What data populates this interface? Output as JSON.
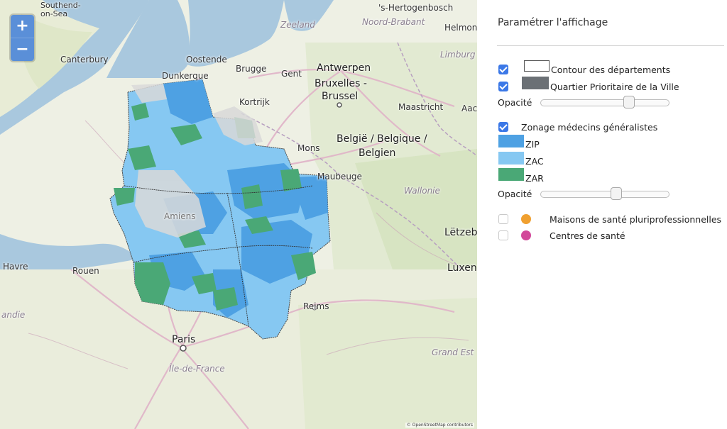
{
  "map": {
    "zoom_in": "+",
    "zoom_out": "−",
    "attribution": "© OpenStreetMap contributors",
    "labels": {
      "southend": "Southend-\non-Sea",
      "hertogenbosch": "'s-Hertogenbosch",
      "zeeland": "Zeeland",
      "noord_brabant": "Noord-Brabant",
      "helmond": "Helmond",
      "limburg": "Limburg",
      "canterbury": "Canterbury",
      "oostende": "Oostende",
      "brugge": "Brugge",
      "gent": "Gent",
      "antwerpen": "Antwerpen",
      "bruxelles": "Bruxelles -",
      "brussel": "Brussel",
      "maastricht": "Maastricht",
      "aachen": "Aach",
      "dunkerque": "Dunkerque",
      "kortrijk": "Kortrijk",
      "belgie1": "België / Belgique /",
      "belgie2": "Belgien",
      "mons": "Mons",
      "maubeuge": "Maubeuge",
      "wallonie": "Wallonie",
      "amiens": "Amiens",
      "letzebuerg": "Lëtzeb",
      "havre": "Havre",
      "rouen": "Rouen",
      "luxembourg": "Luxen",
      "normandie": "andie",
      "reims": "Reims",
      "paris": "Paris",
      "ile_de_france": "Île-de-France",
      "grand_est": "Grand Est"
    }
  },
  "panel": {
    "title": "Paramétrer l'affichage",
    "layers": {
      "contour": {
        "label": "Contour des départements",
        "checked": true
      },
      "qpv": {
        "label": "Quartier Prioritaire de la Ville",
        "checked": true,
        "color": "#6b7075"
      },
      "zonage": {
        "label": "Zonage médecins généralistes",
        "checked": true
      },
      "msp": {
        "label": "Maisons de santé pluriprofessionnelles",
        "checked": false,
        "color": "#f0a030"
      },
      "cds": {
        "label": "Centres de santé",
        "checked": false,
        "color": "#d2499a"
      }
    },
    "opacity_label": "Opacité",
    "opacity_1": 0.7,
    "opacity_2": 0.6,
    "zones": [
      {
        "label": "ZIP",
        "color": "#4ea1e3"
      },
      {
        "label": "ZAC",
        "color": "#86c8f2"
      },
      {
        "label": "ZAR",
        "color": "#4aa876"
      }
    ]
  }
}
